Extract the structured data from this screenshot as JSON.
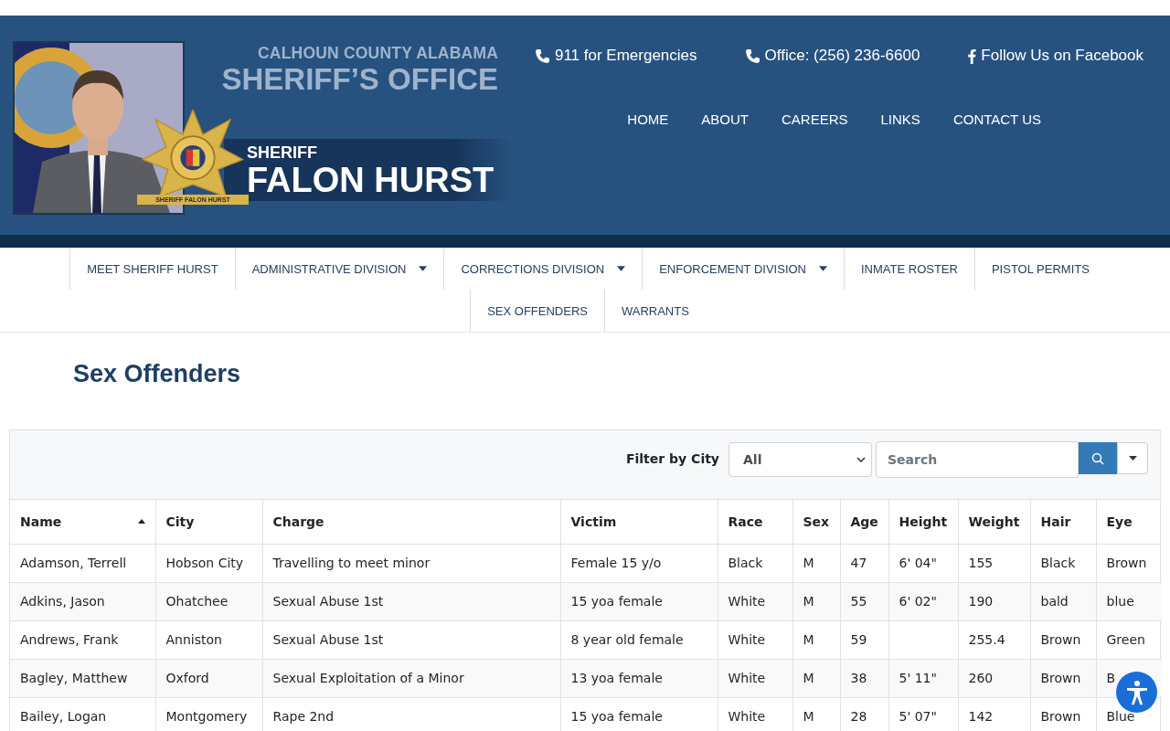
{
  "header": {
    "office_line": "CALHOUN COUNTY ALABAMA",
    "office_title": "SHERIFF’S OFFICE",
    "badge_ribbon": "SHERIFF FALON HURST",
    "sheriff_label": "SHERIFF",
    "sheriff_name": "FALON HURST",
    "contacts": [
      {
        "kind": "phone",
        "label": "911 for Emergencies"
      },
      {
        "kind": "phone",
        "label": "Office: (256) 236-6600"
      },
      {
        "kind": "facebook",
        "label": "Follow Us on Facebook"
      }
    ],
    "menu": [
      "HOME",
      "ABOUT",
      "CAREERS",
      "LINKS",
      "CONTACT US"
    ]
  },
  "nav": [
    {
      "label": "MEET SHERIFF HURST",
      "dropdown": false
    },
    {
      "label": "ADMINISTRATIVE DIVISION",
      "dropdown": true
    },
    {
      "label": "CORRECTIONS DIVISION",
      "dropdown": true
    },
    {
      "label": "ENFORCEMENT DIVISION",
      "dropdown": true
    },
    {
      "label": "INMATE ROSTER",
      "dropdown": false
    },
    {
      "label": "PISTOL PERMITS",
      "dropdown": false
    },
    {
      "label": "SEX OFFENDERS",
      "dropdown": false
    },
    {
      "label": "WARRANTS",
      "dropdown": false
    }
  ],
  "page_title": "Sex Offenders",
  "toolbar": {
    "filter_label": "Filter by City",
    "filter_value": "All",
    "search_placeholder": "Search"
  },
  "table": {
    "columns": [
      {
        "label": "Name",
        "sorted": true
      },
      {
        "label": "City",
        "sorted": false
      },
      {
        "label": "Charge",
        "sorted": false
      },
      {
        "label": "Victim",
        "sorted": false
      },
      {
        "label": "Race",
        "sorted": false
      },
      {
        "label": "Sex",
        "sorted": false
      },
      {
        "label": "Age",
        "sorted": false
      },
      {
        "label": "Height",
        "sorted": false
      },
      {
        "label": "Weight",
        "sorted": false
      },
      {
        "label": "Hair",
        "sorted": false
      },
      {
        "label": "Eye",
        "sorted": false
      }
    ],
    "rows": [
      [
        "Adamson, Terrell",
        "Hobson City",
        "Travelling to meet minor",
        "Female 15 y/o",
        "Black",
        "M",
        "47",
        "6' 04\"",
        "155",
        "Black",
        "Brown"
      ],
      [
        "Adkins, Jason",
        "Ohatchee",
        "Sexual Abuse 1st",
        "15 yoa female",
        "White",
        "M",
        "55",
        "6' 02\"",
        "190",
        "bald",
        "blue"
      ],
      [
        "Andrews, Frank",
        "Anniston",
        "Sexual Abuse 1st",
        "8 year old female",
        "White",
        "M",
        "59",
        "",
        "255.4",
        "Brown",
        "Green"
      ],
      [
        "Bagley, Matthew",
        "Oxford",
        "Sexual Exploitation of a Minor",
        "13 yoa female",
        "White",
        "M",
        "38",
        "5' 11\"",
        "260",
        "Brown",
        "B"
      ],
      [
        "Bailey, Logan",
        "Montgomery",
        "Rape 2nd",
        "15 yoa female",
        "White",
        "M",
        "28",
        "5' 07\"",
        "142",
        "Brown",
        "Blue"
      ]
    ]
  }
}
